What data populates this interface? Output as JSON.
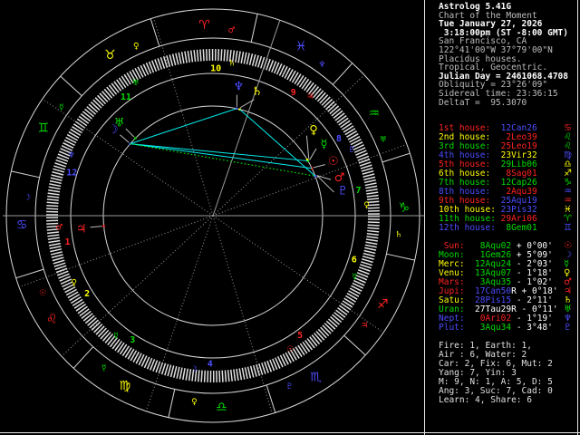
{
  "window": {
    "title": "Astrolog 5.41G"
  },
  "palette": {
    "red": "#ff2222",
    "yellow": "#ffff00",
    "green": "#00dd00",
    "blue": "#4d4dff",
    "white": "#ffffff",
    "dim": "#bdbdbd",
    "cyan": "#00eeee",
    "ring": "#d8d8d8",
    "spoke": "#9a9a9a"
  },
  "sidebar": {
    "info_lines": [
      {
        "text": "Astrolog 5.41G",
        "bright": true
      },
      {
        "text": "Chart of the Moment",
        "bright": false
      },
      {
        "text": "Tue January 27, 2026",
        "bright": true
      },
      {
        "text": " 3:18:00pm (ST -8:00 GMT)",
        "bright": true
      },
      {
        "text": "San Francisco, CA",
        "bright": false
      },
      {
        "text": "122°41'00\"W 37°79'00\"N",
        "bright": false
      },
      {
        "text": "Placidus houses.",
        "bright": false
      },
      {
        "text": "Tropical, Geocentric.",
        "bright": false
      },
      {
        "text": "Julian Day = 2461068.4708",
        "bright": true
      },
      {
        "text": "Obliquity = 23°26'09\"",
        "bright": false
      },
      {
        "text": "Sidereal time: 23:36:15",
        "bright": false
      },
      {
        "text": "DeltaT =  95.3070",
        "bright": false
      }
    ],
    "houses": [
      {
        "label": "1st house:",
        "lcolor": "red",
        "value": "12Can26",
        "vcolor": "blue",
        "glyph": "♋",
        "gcolor": "red"
      },
      {
        "label": "2nd house:",
        "lcolor": "yellow",
        "value": " 2Leo39",
        "vcolor": "red",
        "glyph": "♌",
        "gcolor": "green"
      },
      {
        "label": "3rd house:",
        "lcolor": "green",
        "value": "25Leo19",
        "vcolor": "red",
        "glyph": "♌",
        "gcolor": "green"
      },
      {
        "label": "4th house:",
        "lcolor": "blue",
        "value": "23Vir32",
        "vcolor": "yellow",
        "glyph": "♍",
        "gcolor": "blue"
      },
      {
        "label": "5th house:",
        "lcolor": "red",
        "value": "29Lib06",
        "vcolor": "green",
        "glyph": "♎",
        "gcolor": "yellow"
      },
      {
        "label": "6th house:",
        "lcolor": "yellow",
        "value": " 8Sag01",
        "vcolor": "red",
        "glyph": "♐",
        "gcolor": "yellow"
      },
      {
        "label": "7th house:",
        "lcolor": "green",
        "value": "12Cap26",
        "vcolor": "green",
        "glyph": "♑",
        "gcolor": "green"
      },
      {
        "label": "8th house:",
        "lcolor": "blue",
        "value": " 2Aqu39",
        "vcolor": "red",
        "glyph": "♒",
        "gcolor": "blue"
      },
      {
        "label": "9th house:",
        "lcolor": "red",
        "value": "25Aqu19",
        "vcolor": "blue",
        "glyph": "♒",
        "gcolor": "red"
      },
      {
        "label": "10th house:",
        "lcolor": "yellow",
        "value": "23Pis32",
        "vcolor": "blue",
        "glyph": "♓",
        "gcolor": "yellow"
      },
      {
        "label": "11th house:",
        "lcolor": "green",
        "value": "29Ari06",
        "vcolor": "red",
        "glyph": "♈",
        "gcolor": "green"
      },
      {
        "label": "12th house:",
        "lcolor": "blue",
        "value": " 8Gem01",
        "vcolor": "green",
        "glyph": "♊",
        "gcolor": "blue"
      }
    ],
    "planets": [
      {
        "label": " Sun:",
        "lcolor": "red",
        "value": " 8Aqu02",
        "vcolor": "green",
        "retro": "",
        "delta": "+ 0°00'",
        "glyph": "☉",
        "gcolor": "red"
      },
      {
        "label": "Moon:",
        "lcolor": "green",
        "value": " 1Gem26",
        "vcolor": "green",
        "retro": "",
        "delta": "+ 5°09'",
        "glyph": "☽",
        "gcolor": "blue"
      },
      {
        "label": "Merc:",
        "lcolor": "yellow",
        "value": "12Aqu24",
        "vcolor": "green",
        "retro": "",
        "delta": "- 2°03'",
        "glyph": "☿",
        "gcolor": "green"
      },
      {
        "label": "Venu:",
        "lcolor": "yellow",
        "value": "13Aqu07",
        "vcolor": "green",
        "retro": "",
        "delta": "- 1°18'",
        "glyph": "♀",
        "gcolor": "yellow"
      },
      {
        "label": "Mars:",
        "lcolor": "red",
        "value": " 3Aqu35",
        "vcolor": "green",
        "retro": "",
        "delta": "- 1°02'",
        "glyph": "♂",
        "gcolor": "red"
      },
      {
        "label": "Jupi:",
        "lcolor": "red",
        "value": "17Can50",
        "vcolor": "blue",
        "retro": "R",
        "delta": "+ 0°18'",
        "glyph": "♃",
        "gcolor": "red"
      },
      {
        "label": "Satu:",
        "lcolor": "yellow",
        "value": "28Pis15",
        "vcolor": "blue",
        "retro": "",
        "delta": "- 2°11'",
        "glyph": "♄",
        "gcolor": "yellow"
      },
      {
        "label": "Uran:",
        "lcolor": "green",
        "value": "27Tau29",
        "vcolor": "white",
        "retro": "R",
        "delta": "- 0°11'",
        "glyph": "♅",
        "gcolor": "green"
      },
      {
        "label": "Nept:",
        "lcolor": "blue",
        "value": " 0Ari02",
        "vcolor": "red",
        "retro": "",
        "delta": "- 1°19'",
        "glyph": "♆",
        "gcolor": "blue"
      },
      {
        "label": "Plut:",
        "lcolor": "blue",
        "value": " 3Aqu34",
        "vcolor": "green",
        "retro": "",
        "delta": "- 3°48'",
        "glyph": "♇",
        "gcolor": "blue"
      }
    ],
    "stats": [
      "Fire: 1, Earth: 1,",
      "Air : 6, Water: 2",
      "Car: 2, Fix: 6, Mut: 2",
      "Yang: 7, Yin: 3",
      "M: 9, N: 1, A: 5, D: 5",
      "Ang: 3, Suc: 7, Cad: 0",
      "Learn: 4, Share: 6"
    ]
  },
  "chart_data": {
    "type": "astrology-wheel",
    "ascendant_longitude": 102.433,
    "house_system": "Placidus",
    "zodiac": "Tropical, Geocentric",
    "house_cusps": [
      102.433,
      122.65,
      145.317,
      173.533,
      209.1,
      248.017,
      282.433,
      302.65,
      325.317,
      353.533,
      29.1,
      68.017
    ],
    "house_number_colors": [
      "red",
      "yellow",
      "green",
      "blue",
      "red",
      "yellow",
      "green",
      "blue",
      "red",
      "yellow",
      "green",
      "blue"
    ],
    "house_rulers": [
      {
        "glyph": "♂",
        "color": "red"
      },
      {
        "glyph": "♀",
        "color": "yellow"
      },
      {
        "glyph": "☿",
        "color": "green"
      },
      {
        "glyph": "☽",
        "color": "blue"
      },
      {
        "glyph": "☉",
        "color": "red"
      },
      {
        "glyph": "☿",
        "color": "green"
      },
      {
        "glyph": "♀",
        "color": "yellow"
      },
      {
        "glyph": "♇",
        "color": "blue"
      },
      {
        "glyph": "♃",
        "color": "red"
      },
      {
        "glyph": "♄",
        "color": "yellow"
      },
      {
        "glyph": "♅",
        "color": "green"
      },
      {
        "glyph": "♆",
        "color": "blue"
      }
    ],
    "signs": [
      {
        "name": "aries",
        "glyph": "♈",
        "color": "red",
        "ruler": "♂",
        "ruler_color": "red"
      },
      {
        "name": "taurus",
        "glyph": "♉",
        "color": "yellow",
        "ruler": "♀",
        "ruler_color": "yellow"
      },
      {
        "name": "gemini",
        "glyph": "♊",
        "color": "green",
        "ruler": "☿",
        "ruler_color": "green"
      },
      {
        "name": "cancer",
        "glyph": "♋",
        "color": "blue",
        "ruler": "☽",
        "ruler_color": "blue"
      },
      {
        "name": "leo",
        "glyph": "♌",
        "color": "red",
        "ruler": "☉",
        "ruler_color": "red"
      },
      {
        "name": "virgo",
        "glyph": "♍",
        "color": "yellow",
        "ruler": "☿",
        "ruler_color": "green"
      },
      {
        "name": "libra",
        "glyph": "♎",
        "color": "green",
        "ruler": "♀",
        "ruler_color": "yellow"
      },
      {
        "name": "scorpio",
        "glyph": "♏",
        "color": "blue",
        "ruler": "♇",
        "ruler_color": "blue"
      },
      {
        "name": "sagittarius",
        "glyph": "♐",
        "color": "red",
        "ruler": "♃",
        "ruler_color": "red"
      },
      {
        "name": "capricorn",
        "glyph": "♑",
        "color": "green",
        "ruler": "♄",
        "ruler_color": "yellow"
      },
      {
        "name": "aquarius",
        "glyph": "♒",
        "color": "green",
        "ruler": "♅",
        "ruler_color": "green"
      },
      {
        "name": "pisces",
        "glyph": "♓",
        "color": "blue",
        "ruler": "♆",
        "ruler_color": "blue"
      }
    ],
    "planets": [
      {
        "name": "sun",
        "glyph": "☉",
        "color": "red",
        "longitude": 308.033,
        "display_phi": 24.5
      },
      {
        "name": "moon",
        "glyph": "☽",
        "color": "blue",
        "longitude": 61.433
      },
      {
        "name": "mercury",
        "glyph": "☿",
        "color": "green",
        "longitude": 312.4,
        "display_phi": 33
      },
      {
        "name": "venus",
        "glyph": "♀",
        "color": "yellow",
        "longitude": 313.117,
        "display_phi": 40.5
      },
      {
        "name": "mars",
        "glyph": "♂",
        "color": "red",
        "longitude": 303.583,
        "display_phi": 17
      },
      {
        "name": "jupiter",
        "glyph": "♃",
        "color": "red",
        "longitude": 107.833
      },
      {
        "name": "saturn",
        "glyph": "♄",
        "color": "yellow",
        "longitude": 358.25,
        "display_phi": 70.5
      },
      {
        "name": "uranus",
        "glyph": "♅",
        "color": "green",
        "longitude": 57.483
      },
      {
        "name": "neptune",
        "glyph": "♆",
        "color": "blue",
        "longitude": 0.033,
        "display_phi": 78.8
      },
      {
        "name": "pluto",
        "glyph": "♇",
        "color": "blue",
        "longitude": 303.567,
        "display_phi": 11
      }
    ],
    "aspect_lines": [
      {
        "from": "moon",
        "to": "neptune",
        "color": "cyan",
        "style": "solid"
      },
      {
        "from": "moon",
        "to": "sun",
        "color": "cyan",
        "style": "solid"
      },
      {
        "from": "moon",
        "to": "mercury",
        "color": "cyan",
        "style": "solid"
      },
      {
        "from": "saturn",
        "to": "mars",
        "color": "cyan",
        "style": "solid"
      },
      {
        "from": "moon",
        "to": "mars",
        "color": "green",
        "style": "dotted"
      },
      {
        "from": "moon",
        "to": "pluto",
        "color": "green",
        "style": "dotted"
      }
    ]
  }
}
